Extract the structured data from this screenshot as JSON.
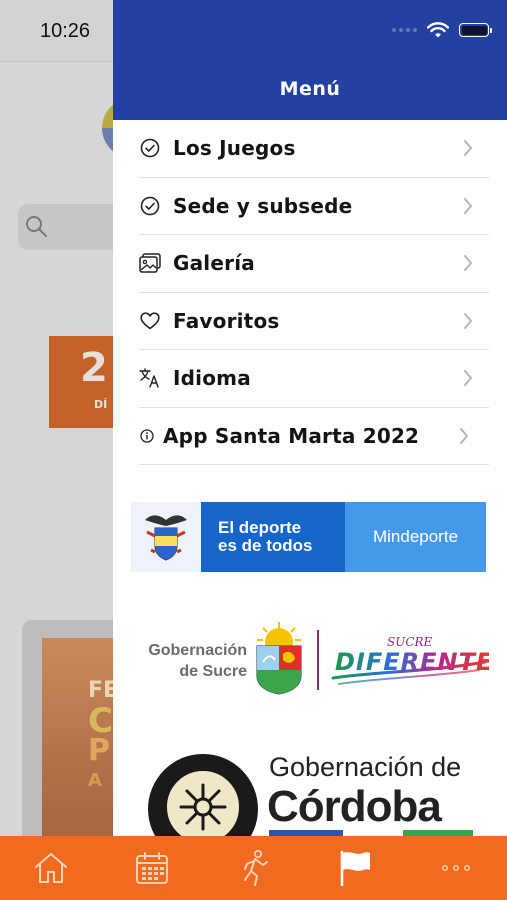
{
  "status_bar": {
    "time": "10:26"
  },
  "background": {
    "countdown_number": "2",
    "countdown_unit": "DÍ",
    "card_text": [
      "FE",
      "C",
      "P",
      "A"
    ]
  },
  "drawer": {
    "title": "Menú",
    "items": [
      {
        "label": "Los Juegos",
        "icon": "check-circle-icon"
      },
      {
        "label": "Sede y subsede",
        "icon": "check-circle-icon"
      },
      {
        "label": "Galería",
        "icon": "gallery-icon"
      },
      {
        "label": "Favoritos",
        "icon": "heart-icon"
      },
      {
        "label": "Idioma",
        "icon": "translate-icon"
      },
      {
        "label": "App Santa Marta 2022",
        "icon": "info-circle-icon"
      }
    ]
  },
  "sponsors": {
    "mindeporte_slogan_line1": "El deporte",
    "mindeporte_slogan_line2": "es de todos",
    "mindeporte_name": "Mindeporte",
    "sucre_line1": "Gobernación",
    "sucre_line2": "de Sucre",
    "sucre_brand_top": "SUCRE",
    "sucre_brand": "DIFERENTE",
    "cordoba_line1": "Gobernación de",
    "cordoba_line2": "Córdoba"
  },
  "tabbar": {
    "tabs": [
      {
        "icon": "home-icon",
        "active": false
      },
      {
        "icon": "calendar-icon",
        "active": false
      },
      {
        "icon": "runner-icon",
        "active": false
      },
      {
        "icon": "flag-icon",
        "active": true
      },
      {
        "icon": "more-icon",
        "active": false
      }
    ]
  },
  "colors": {
    "drawer_header": "#2341a0",
    "tabbar": "#f06a1f",
    "mindeporte_dark": "#1665c8",
    "mindeporte_light": "#4599ea"
  }
}
